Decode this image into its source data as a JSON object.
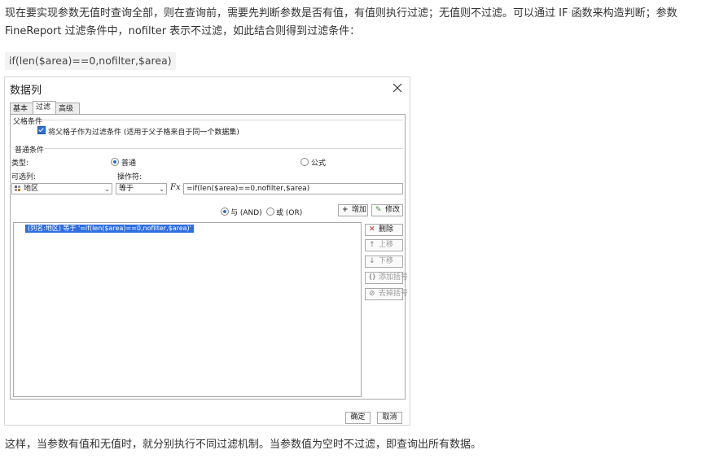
{
  "article": {
    "paragraph1": "现在要实现参数无值时查询全部，则在查询前，需要先判断参数是否有值，有值则执行过滤；无值则不过滤。可以通过 IF 函数来构造判断；参数 FineReport 过滤条件中，nofilter 表示不过滤，如此结合则得到过滤条件：",
    "code": "if(len($area)==0,nofilter,$area)",
    "paragraph2": "这样，当参数有值和无值时，就分别执行不同过滤机制。当参数值为空时不过滤，即查询出所有数据。"
  },
  "dialog": {
    "title": "数据列",
    "tabs": [
      {
        "label": "基本"
      },
      {
        "label": "过滤",
        "active": true
      },
      {
        "label": "高级"
      }
    ],
    "parent_section": {
      "title": "父格条件",
      "checkbox_label": "将父格子作为过滤条件 (适用于父子格来自于同一个数据集)",
      "checked": true
    },
    "normal_section": {
      "title": "普通条件",
      "type_label": "类型:",
      "type_options": [
        {
          "label": "普通",
          "selected": true
        },
        {
          "label": "公式",
          "selected": false
        }
      ],
      "column_label": "可选列:",
      "operator_label": "操作符:",
      "column_value": "地区",
      "operator_value": "等于",
      "fx_label": "Fx",
      "formula_value": "=if(len($area)==0,nofilter,$area)"
    },
    "logic": {
      "and_label": "与 (AND)",
      "or_label": "或 (OR)",
      "and_selected": true
    },
    "buttons": {
      "add": "增加",
      "modify": "修改",
      "delete": "删除",
      "up": "上移",
      "down": "下移",
      "add_bracket": "添加括号",
      "remove_bracket": "去掉括号",
      "ok": "确定",
      "cancel": "取消"
    },
    "condition_row": "(列名:地区) 等于 '=if(len($area)==0,nofilter,$area)'"
  },
  "colors": {
    "accent": "#2d6fd6",
    "selection": "#2f6fe0",
    "delete_icon": "#d9262b",
    "modify_icon": "#3a9a3a"
  }
}
